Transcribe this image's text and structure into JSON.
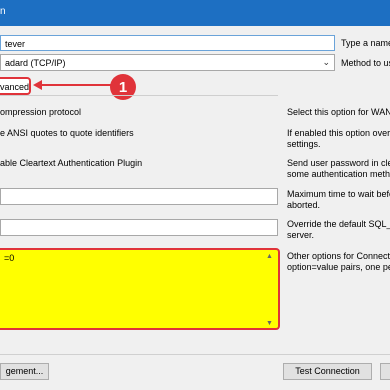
{
  "window": {
    "title": "n"
  },
  "name_field": {
    "value": "tever",
    "label": "Type a name"
  },
  "method_field": {
    "value": "adard (TCP/IP)",
    "label": "Method to us"
  },
  "tab": {
    "label": "vanced",
    "badge": "1"
  },
  "options": [
    {
      "label": "ompression protocol",
      "desc1": "Select this option for WAN",
      "desc2": ""
    },
    {
      "label": "e ANSI quotes to quote identifiers",
      "desc1": "If enabled this option over",
      "desc2": "settings."
    },
    {
      "label": "able Cleartext Authentication Plugin",
      "desc1": "Send user password in clea",
      "desc2": "some authentication metho"
    }
  ],
  "timeout": {
    "value": "",
    "desc1": "Maximum time to wait befor",
    "desc2": "aborted."
  },
  "sql_mode": {
    "value": "",
    "desc1": "Override the default SQL_",
    "desc2": "server."
  },
  "others": {
    "value": "=0",
    "desc1": "Other options for Connecto",
    "desc2": "option=value pairs, one pe"
  },
  "buttons": {
    "manage": "gement...",
    "test": "Test Connection"
  }
}
